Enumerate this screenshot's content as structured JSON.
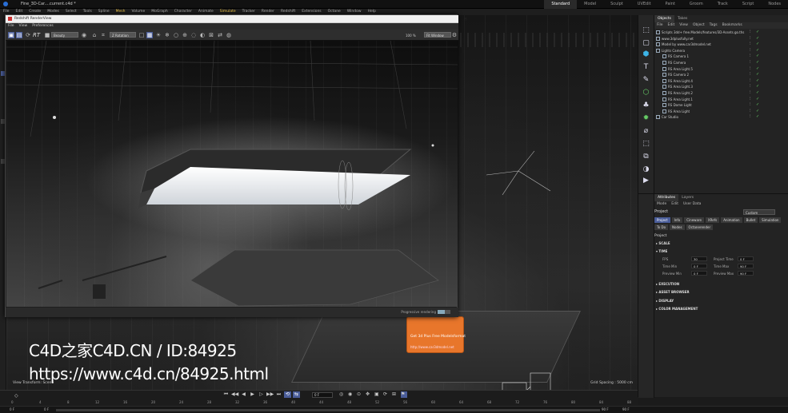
{
  "app": {
    "window_title": "Fine_3D-Car....current.c4d *",
    "layouts": [
      "Standard",
      "Model",
      "Sculpt",
      "UVEdit",
      "Paint",
      "Groom",
      "Track",
      "Script",
      "Nodes"
    ]
  },
  "menubar": [
    "File",
    "Edit",
    "Create",
    "Modes",
    "Select",
    "Tools",
    "Spline",
    "Mesh",
    "Volume",
    "MoGraph",
    "Character",
    "Animate",
    "Simulate",
    "Tracker",
    "Render",
    "Redshift",
    "Extensions",
    "Octane",
    "Window",
    "Help"
  ],
  "render_view": {
    "title": "Redshift RenderView",
    "menu": [
      "File",
      "View",
      "Preferences"
    ],
    "mode_select": "Beauty",
    "rt_label": "RT",
    "render_select": "Z Rotation",
    "zoom": "100 %",
    "fit_select": "Fit Window",
    "status_text": "Progressive rendering",
    "progress": 0.55,
    "window_controls": [
      "–",
      "▢",
      "✕"
    ]
  },
  "viewport": {
    "label_left": "View Transform: Scene",
    "label_right": "Grid Spacing : 5000 cm",
    "tooltip_line1": "Get 3d Plus Free Modelsformat",
    "tooltip_line2": "http://www.car3dmodel.net"
  },
  "watermark": {
    "line1": "C4D之家C4D.CN / ID:84925",
    "line2": "https://www.c4d.cn/84925.html"
  },
  "objects_panel": {
    "tabs": [
      "Objects",
      "Takes"
    ],
    "menu": [
      "File",
      "Edit",
      "View",
      "Object",
      "Tags",
      "Bookmarks"
    ],
    "rows": [
      {
        "name": "Scripts 3dd+ free.Models/features/3D-Assets.go.ths",
        "indent": 0
      },
      {
        "name": "www.3dplusfully.net",
        "indent": 0
      },
      {
        "name": "Model by www.car3dmodel.net",
        "indent": 0
      },
      {
        "name": "Lights Camera",
        "indent": 0
      },
      {
        "name": "RS Camera 1",
        "indent": 1
      },
      {
        "name": "RS Camera",
        "indent": 1
      },
      {
        "name": "RS Area Light.5",
        "indent": 1
      },
      {
        "name": "RS Camera 2",
        "indent": 1
      },
      {
        "name": "RS Area Light.4",
        "indent": 1
      },
      {
        "name": "RS Area Light.3",
        "indent": 1
      },
      {
        "name": "RS Area Light.2",
        "indent": 1
      },
      {
        "name": "RS Area Light.1",
        "indent": 1
      },
      {
        "name": "RS Dome Light",
        "indent": 1
      },
      {
        "name": "RS Area Light",
        "indent": 1
      },
      {
        "name": "Car Studio",
        "indent": 0
      }
    ]
  },
  "attributes_panel": {
    "tabs": [
      "Attributes",
      "Layers"
    ],
    "menu": [
      "Mode",
      "Edit",
      "User Data"
    ],
    "mode_label": "Project",
    "mode_select": "Custom",
    "buttons": [
      "Project",
      "Info",
      "Cineware",
      "XRefs",
      "Animation",
      "Bullet",
      "Simulation",
      "To Do",
      "Nodes",
      "Octanerender"
    ],
    "section_title": "Project",
    "sections": {
      "scale": "SCALE",
      "time": "TIME",
      "execution": "EXECUTION",
      "asset_browser": "ASSET BROWSER",
      "display": "DISPLAY",
      "color_management": "COLOR MANAGEMENT"
    },
    "fields": {
      "fps_label": "FPS",
      "fps_value": "30",
      "project_time_label": "Project Time",
      "project_time_value": "0 F",
      "min_time_label": "Time Min",
      "min_time_value": "0 F",
      "max_time_label": "Time Max",
      "max_time_value": "90 F",
      "preview_min_label": "Preview Min",
      "preview_min_value": "0 F",
      "preview_max_label": "Preview Max",
      "preview_max_value": "90 F"
    }
  },
  "timeline": {
    "current_frame": "0 F",
    "ticks": [
      "0",
      "4",
      "8",
      "12",
      "16",
      "20",
      "24",
      "28",
      "32",
      "36",
      "40",
      "44",
      "48",
      "52",
      "56",
      "60",
      "64",
      "68",
      "72",
      "76",
      "80",
      "84",
      "88"
    ],
    "start": "0 F",
    "start2": "0 F",
    "end": "90 F",
    "end2": "90 F"
  },
  "colors": {
    "accent": "#4a5d99",
    "tooltip": "#e8762b",
    "check": "#66cc66"
  }
}
